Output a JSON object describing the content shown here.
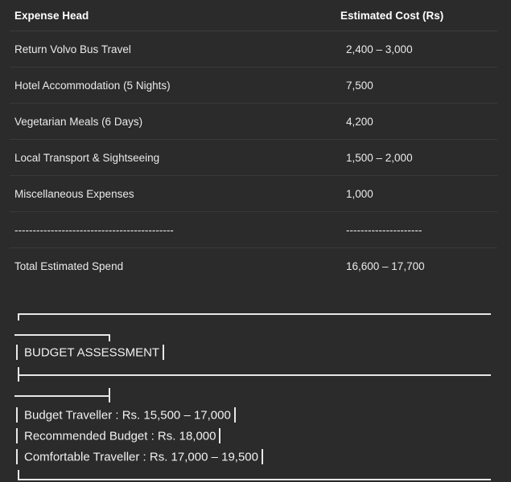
{
  "table": {
    "headers": {
      "expense": "Expense Head",
      "cost": "Estimated Cost (Rs)"
    },
    "rows": [
      {
        "expense": "Return Volvo Bus Travel",
        "cost": "2,400 – 3,000"
      },
      {
        "expense": "Hotel Accommodation (5 Nights)",
        "cost": "7,500"
      },
      {
        "expense": "Vegetarian Meals (6 Days)",
        "cost": "4,200"
      },
      {
        "expense": "Local Transport & Sightseeing",
        "cost": "1,500 – 2,000"
      },
      {
        "expense": "Miscellaneous Expenses",
        "cost": "1,000"
      },
      {
        "expense": "--------------------------------------------",
        "cost": "---------------------"
      },
      {
        "expense": "Total Estimated Spend",
        "cost": "16,600 – 17,700"
      }
    ]
  },
  "assessment": {
    "title": "BUDGET ASSESSMENT",
    "lines": [
      "Budget Traveller : Rs. 15,500 – 17,000",
      "Recommended Budget : Rs. 18,000",
      "Comfortable Traveller : Rs. 17,000 – 19,500"
    ]
  }
}
